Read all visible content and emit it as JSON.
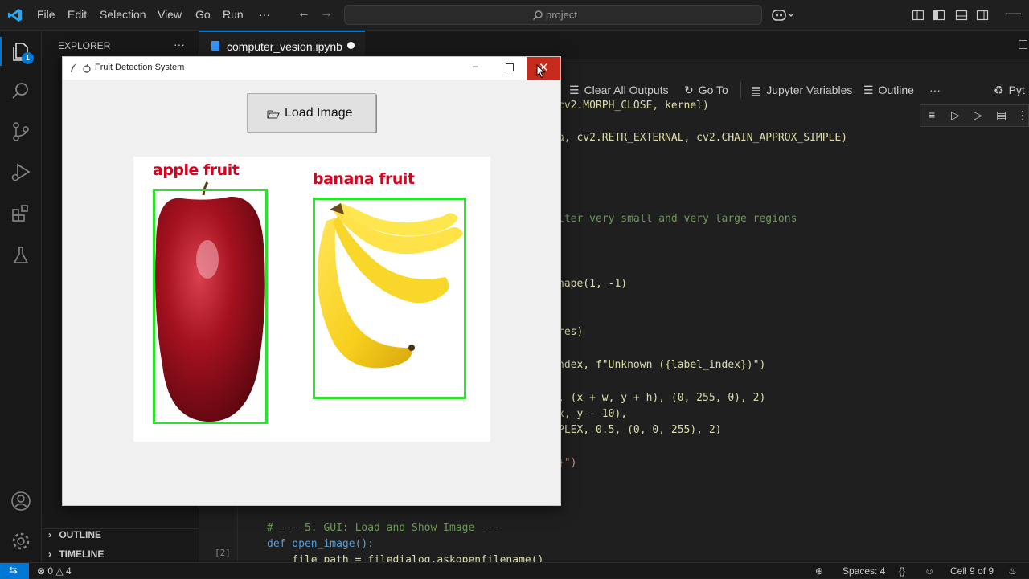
{
  "titlebar": {
    "menus": [
      "File",
      "Edit",
      "Selection",
      "View",
      "Go",
      "Run",
      "···"
    ],
    "search_placeholder": "project"
  },
  "activity": {
    "explorer_badge": "1"
  },
  "sidebar": {
    "title": "EXPLORER",
    "more": "···",
    "outline": "OUTLINE",
    "timeline": "TIMELINE"
  },
  "editor": {
    "tab_name": "computer_vesion.ipynb",
    "toolbar": {
      "clear_outputs": "Clear All Outputs",
      "go_to": "Go To",
      "jupyter_variables": "Jupyter Variables",
      "outline": "Outline",
      "more": "···",
      "kernel": "Pyt"
    },
    "code_lines": [
      "cv2.MORPH_CLOSE, kernel)",
      "a, cv2.RETR_EXTERNAL, cv2.CHAIN_APPROX_SIMPLE)",
      "lter very small and very large regions",
      "hape(1, -1)",
      "res)",
      "ndex, f\"Unknown ({label_index})\")",
      ", (x + w, y + h), (0, 255, 0), 2)",
      "x, y - 10),",
      "PLEX, 0.5, (0, 0, 255), 2)",
      "}\")",
      "# --- 5. GUI: Load and Show Image ---",
      "def open_image():",
      "    file_path = filedialog.askopenfilename()"
    ],
    "cell_label": "[2]"
  },
  "statusbar": {
    "errors": "0",
    "warnings": "4",
    "spaces": "Spaces: 4",
    "braces": "{}",
    "cell": "Cell 9 of 9"
  },
  "tk_window": {
    "title": "Fruit Detection System",
    "load_button": "Load Image",
    "detections": [
      {
        "label": "apple fruit"
      },
      {
        "label": "banana fruit"
      }
    ]
  }
}
